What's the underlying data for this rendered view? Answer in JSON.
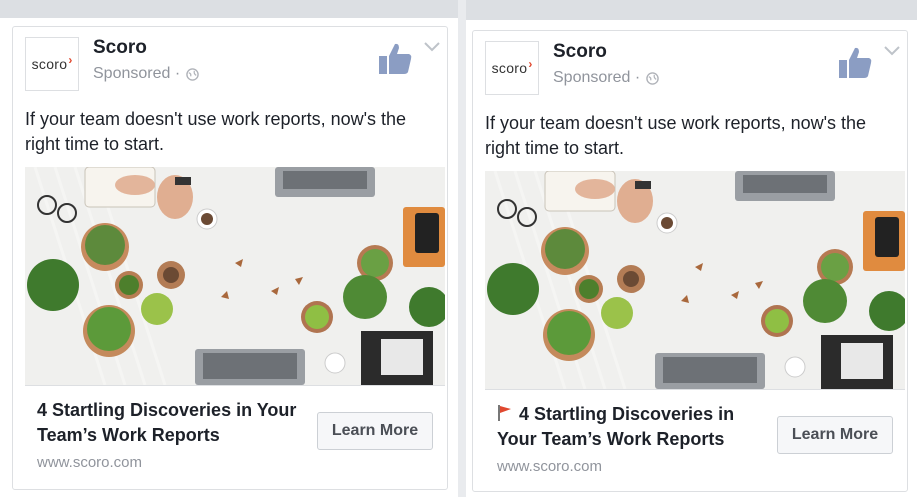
{
  "ads": [
    {
      "page_name": "Scoro",
      "sponsored_label": "Sponsored ·",
      "logo_text": "scoro",
      "post_text": "If your team doesn't use work reports, now's the right time to start.",
      "headline": "4 Startling Discoveries in Your Team’s Work Reports",
      "url": "www.scoro.com",
      "cta_label": "Learn More",
      "headline_icon": null
    },
    {
      "page_name": "Scoro",
      "sponsored_label": "Sponsored ·",
      "logo_text": "scoro",
      "post_text": "If your team doesn't use work reports, now's the right time to start.",
      "headline": "4 Startling Discoveries in Your Team’s Work Reports",
      "url": "www.scoro.com",
      "cta_label": "Learn More",
      "headline_icon": "red-flag-icon"
    }
  ],
  "colors": {
    "text_primary": "#1d2129",
    "text_secondary": "#90949c",
    "like_icon": "#8b9dc3",
    "brand_mark": "#e0482f",
    "flag": "#e0482f"
  },
  "icons": {
    "like": "thumbs-up-icon",
    "menu": "chevron-down-icon",
    "audience": "globe-icon"
  }
}
